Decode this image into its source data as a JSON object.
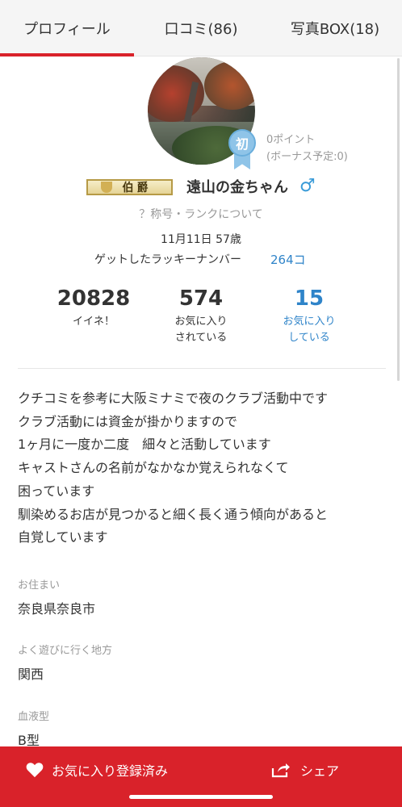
{
  "tabs": [
    {
      "label": "プロフィール",
      "active": true
    },
    {
      "label": "口コミ(86)",
      "active": false
    },
    {
      "label": "写真BOX(18)",
      "active": false
    }
  ],
  "profile": {
    "badge_label": "初",
    "points": "0ポイント",
    "bonus": "(ボーナス予定:0)",
    "title_plate": "伯爵",
    "name": "遠山の金ちゃん",
    "gender_symbol": "♂",
    "rank_link": "？称号・ランクについて",
    "birth_age": "11月11日 57歳",
    "lucky_label": "ゲットしたラッキーナンバー",
    "lucky_count": "264コ"
  },
  "stats": [
    {
      "value": "20828",
      "label_1": "イイネ！",
      "label_2": ""
    },
    {
      "value": "574",
      "label_1": "お気に入り",
      "label_2": "されている"
    },
    {
      "value": "15",
      "label_1": "お気に入り",
      "label_2": "している"
    }
  ],
  "bio_lines": [
    "クチコミを参考に大阪ミナミで夜のクラブ活動中です",
    "クラブ活動には資金が掛かりますので",
    "1ヶ月に一度か二度　細々と活動しています",
    "キャストさんの名前がなかなか覚えられなくて",
    "困っています",
    "馴染めるお店が見つかると細く長く通う傾向があると",
    "自覚しています"
  ],
  "fields": [
    {
      "label": "お住まい",
      "value": "奈良県奈良市"
    },
    {
      "label": "よく遊びに行く地方",
      "value": "関西"
    },
    {
      "label": "血液型",
      "value": "B型"
    }
  ],
  "bottom": {
    "favorite_label": "お気に入り登録済み",
    "share_label": "シェア"
  },
  "colors": {
    "accent": "#d9222a",
    "link": "#2f84c9"
  }
}
